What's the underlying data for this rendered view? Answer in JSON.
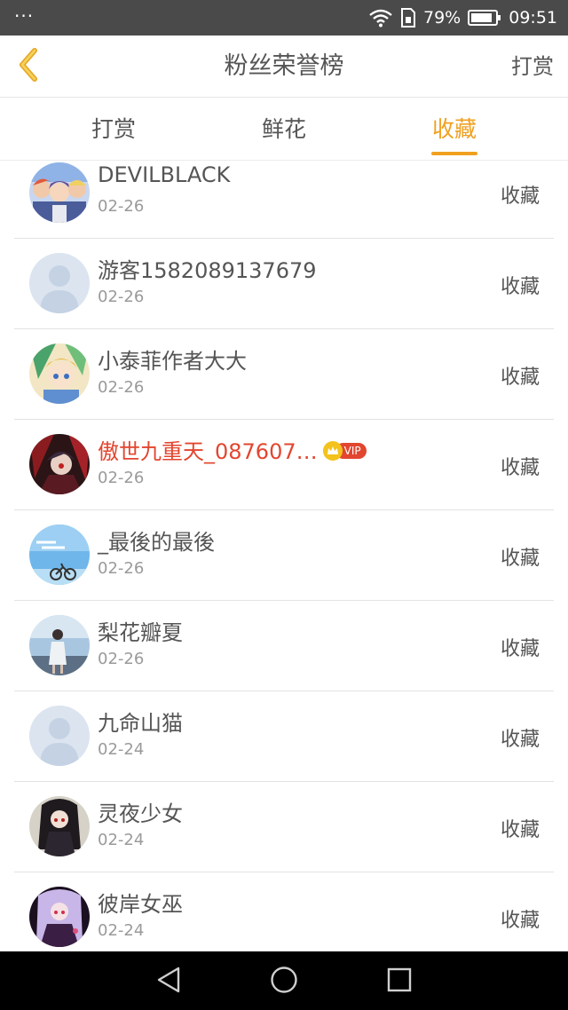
{
  "status_bar": {
    "dots": "···",
    "battery": "79%",
    "time": "09:51"
  },
  "header": {
    "title": "粉丝荣誉榜",
    "action": "打赏"
  },
  "tabs": [
    {
      "label": "打赏",
      "active": false
    },
    {
      "label": "鲜花",
      "active": false
    },
    {
      "label": "收藏",
      "active": true
    }
  ],
  "vip_label": "VIP",
  "rows": [
    {
      "name": "DEVILBLACK",
      "date": "02-26",
      "action": "收藏",
      "vip": false,
      "avatar": "anime-group"
    },
    {
      "name": "游客1582089137679",
      "date": "02-26",
      "action": "收藏",
      "vip": false,
      "avatar": "default"
    },
    {
      "name": "小泰菲作者大大",
      "date": "02-26",
      "action": "收藏",
      "vip": false,
      "avatar": "anime-girl-green"
    },
    {
      "name": "傲世九重天_087607…",
      "date": "02-26",
      "action": "收藏",
      "vip": true,
      "avatar": "dark-red"
    },
    {
      "name": "_最後的最後",
      "date": "02-26",
      "action": "收藏",
      "vip": false,
      "avatar": "sky-bike"
    },
    {
      "name": "梨花瓣夏",
      "date": "02-26",
      "action": "收藏",
      "vip": false,
      "avatar": "girl-sky"
    },
    {
      "name": "九命山猫",
      "date": "02-24",
      "action": "收藏",
      "vip": false,
      "avatar": "default"
    },
    {
      "name": "灵夜少女",
      "date": "02-24",
      "action": "收藏",
      "vip": false,
      "avatar": "anime-dark"
    },
    {
      "name": "彼岸女巫",
      "date": "02-24",
      "action": "收藏",
      "vip": false,
      "avatar": "anime-purple"
    }
  ],
  "colors": {
    "accent": "#f0a020",
    "vip_name": "#e2462f",
    "status_bar": "#4a4a4a"
  }
}
